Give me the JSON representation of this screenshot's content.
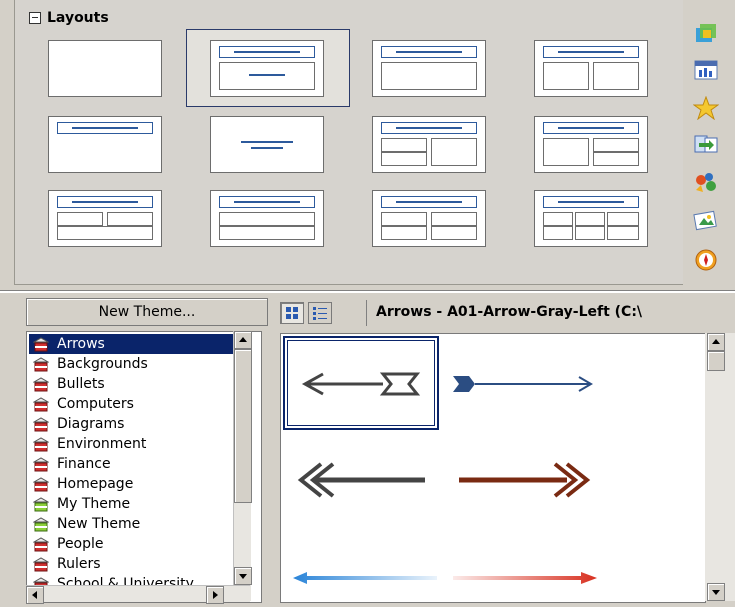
{
  "layouts": {
    "header": "Layouts"
  },
  "gallery": {
    "new_theme_label": "New Theme...",
    "title": "Arrows - A01-Arrow-Gray-Left (C:\\",
    "view_icon_label": "icon-view-icon",
    "view_detail_label": "detail-view-icon",
    "themes": [
      {
        "label": "Arrows",
        "selected": true
      },
      {
        "label": "Backgrounds"
      },
      {
        "label": "Bullets"
      },
      {
        "label": "Computers"
      },
      {
        "label": "Diagrams"
      },
      {
        "label": "Environment"
      },
      {
        "label": "Finance"
      },
      {
        "label": "Homepage"
      },
      {
        "label": "My Theme",
        "green": true
      },
      {
        "label": "New Theme",
        "green": true
      },
      {
        "label": "People"
      },
      {
        "label": "Rulers"
      },
      {
        "label": "School & University"
      }
    ]
  },
  "sidebar_icons": [
    "cube-icon",
    "chart-icon",
    "star-icon",
    "transition-icon",
    "animation-icon",
    "gallery-icon",
    "navigator-icon"
  ],
  "colors": {
    "selection": "#0a246a",
    "layout_blue": "#2d5a9c",
    "arrow_gray": "#444444",
    "arrow_blue": "#2b4d82",
    "arrow_brown": "#7a2a12",
    "arrow_lightblue": "#2a84d8",
    "arrow_red": "#d83020"
  }
}
